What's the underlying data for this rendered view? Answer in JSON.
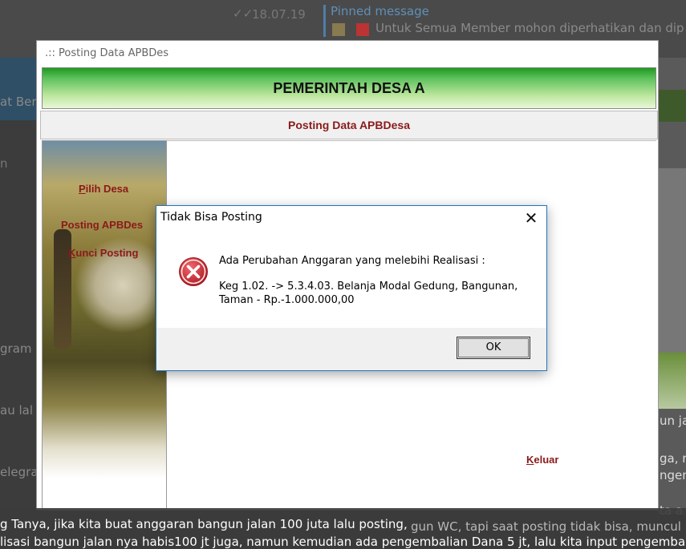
{
  "background": {
    "timestamp": "18.07.19",
    "pinned_title": "Pinned message",
    "pinned_text": "Untuk Semua Member mohon diperhatikan dan dip",
    "left_snippets": [
      "at Ber",
      "n",
      "gram",
      "au lal",
      "elegra"
    ],
    "right_snippets": [
      "un ja",
      "ga, n",
      "ngem",
      "ta a"
    ],
    "behind_text": "gun WC, tapi saat posting tidak bisa, muncul p",
    "colors": {
      "pinned": "#5f8fb8"
    }
  },
  "window": {
    "title": ".:: Posting Data APBDes",
    "banner": "PEMERINTAH DESA A",
    "subheader": "Posting Data APBDesa",
    "menu": [
      {
        "label": "Pilih Desa",
        "accel": "P",
        "rest": "ilih Desa"
      },
      {
        "label": "Posting APBDes",
        "accel": "",
        "rest": "Posting APBDes"
      },
      {
        "label": "Kunci Posting",
        "accel": "K",
        "rest": "unci Posting"
      }
    ],
    "exit": {
      "accel": "K",
      "rest": "eluar"
    }
  },
  "dialog": {
    "title": "Tidak Bisa Posting",
    "close": "✕",
    "icon": "error-icon",
    "message_line1": "Ada Perubahan Anggaran yang melebihi Realisasi :",
    "message_line2": "Keg 1.02. -> 5.3.4.03.  Belanja Modal Gedung, Bangunan, Taman -  Rp.-1.000.000,00",
    "ok_label": "OK",
    "colors": {
      "icon": "#c4262e",
      "border": "#1e74c8"
    }
  },
  "chat_bottom": {
    "line1": "g Tanya, jika kita buat anggaran bangun jalan 100 juta lalu posting,",
    "line2": "lisasi bangun jalan nya habis100 jt juga, namun kemudian ada pengembalian Dana 5 jt, lalu kita input pengembali"
  }
}
